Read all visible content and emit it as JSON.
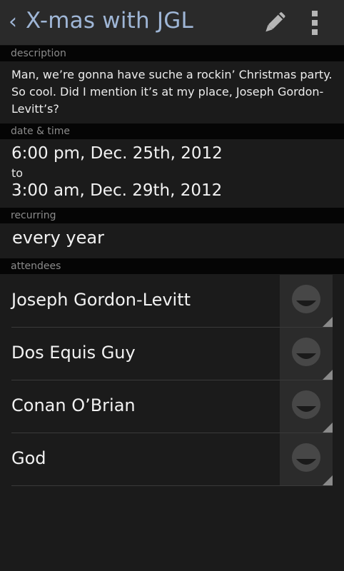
{
  "header": {
    "back_glyph": "‹",
    "title": "X-mas with JGL",
    "accent_color": "#9fb6d6",
    "icons": [
      "back-icon",
      "pencil-icon",
      "overflow-menu-icon"
    ]
  },
  "sections": {
    "description_label": "description",
    "datetime_label": "date & time",
    "recurring_label": "recurring",
    "attendees_label": "attendees"
  },
  "description": {
    "text": "Man, we’re gonna have suche a rockin’ Christmas party. So cool. Did I mention it’s at my place, Joseph Gordon-Levitt’s?"
  },
  "datetime": {
    "start": "6:00 pm, Dec. 25th, 2012",
    "separator": "to",
    "end": "3:00 am, Dec. 29th, 2012"
  },
  "recurring": {
    "value": "every year"
  },
  "attendees": [
    {
      "name": "Joseph Gordon-Levitt"
    },
    {
      "name": "Dos Equis Guy"
    },
    {
      "name": "Conan O’Brian"
    },
    {
      "name": "God"
    }
  ]
}
